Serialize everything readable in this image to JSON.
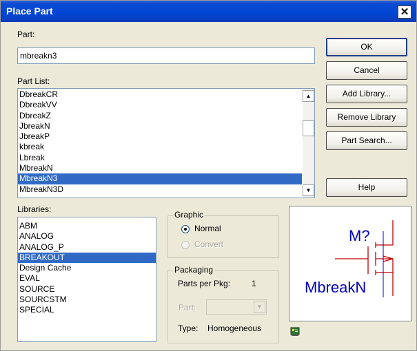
{
  "window": {
    "title": "Place Part",
    "close_glyph": "✕"
  },
  "part": {
    "label": "Part:",
    "value": "mbreakn3"
  },
  "part_list": {
    "label": "Part List:",
    "items": [
      "DbreakCR",
      "DbreakVV",
      "DbreakZ",
      "JbreakN",
      "JbreakP",
      "kbreak",
      "Lbreak",
      "MbreakN",
      "MbreakN3",
      "MbreakN3D"
    ],
    "selected_index": 8
  },
  "buttons": {
    "ok": "OK",
    "cancel": "Cancel",
    "add_library": "Add Library...",
    "remove_library": "Remove Library",
    "part_search": "Part Search...",
    "help": "Help"
  },
  "libraries": {
    "label": "Libraries:",
    "items": [
      "ABM",
      "ANALOG",
      "ANALOG_P",
      "BREAKOUT",
      "Design Cache",
      "EVAL",
      "SOURCE",
      "SOURCSTM",
      "SPECIAL"
    ],
    "selected_index": 3
  },
  "graphic": {
    "legend": "Graphic",
    "normal": "Normal",
    "convert": "Convert"
  },
  "packaging": {
    "legend": "Packaging",
    "parts_per_pkg_label": "Parts per Pkg:",
    "parts_per_pkg_value": "1",
    "part_label": "Part:",
    "type_label": "Type:",
    "type_value": "Homogeneous"
  },
  "preview": {
    "ref_designator": "M?",
    "part_name": "MbreakN",
    "symbol_color": "#c00000",
    "text_color": "#0000c0"
  },
  "colors": {
    "titlebar": "#0046d5",
    "selection": "#316ac5",
    "dialog_bg": "#ece9d8"
  }
}
